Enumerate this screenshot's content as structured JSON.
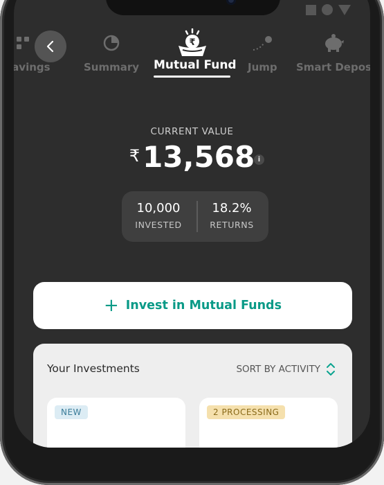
{
  "tabs": [
    {
      "label": "i Savings",
      "icon": "grid-icon"
    },
    {
      "label": "Summary",
      "icon": "pie-chart-icon"
    },
    {
      "label": "Mutual Fund",
      "icon": "rupee-basket-icon",
      "active": true
    },
    {
      "label": "Jump",
      "icon": "jump-path-icon"
    },
    {
      "label": "Smart Depos",
      "icon": "piggy-bank-icon"
    }
  ],
  "summary": {
    "current_value_label": "CURRENT VALUE",
    "currency_symbol": "₹",
    "current_value": "13,568",
    "invested_value": "10,000",
    "invested_label": "INVESTED",
    "returns_value": "18.2%",
    "returns_label": "RETURNS"
  },
  "invest_button": {
    "label": "Invest in Mutual Funds"
  },
  "investments": {
    "title": "Your Investments",
    "sort_label": "SORT BY ACTIVITY",
    "items": [
      {
        "badge": "NEW"
      },
      {
        "badge": "2 PROCESSING"
      }
    ]
  },
  "colors": {
    "accent": "#0a9a87",
    "background_dark": "#2d2d2d",
    "card_light": "#eeeeee"
  }
}
